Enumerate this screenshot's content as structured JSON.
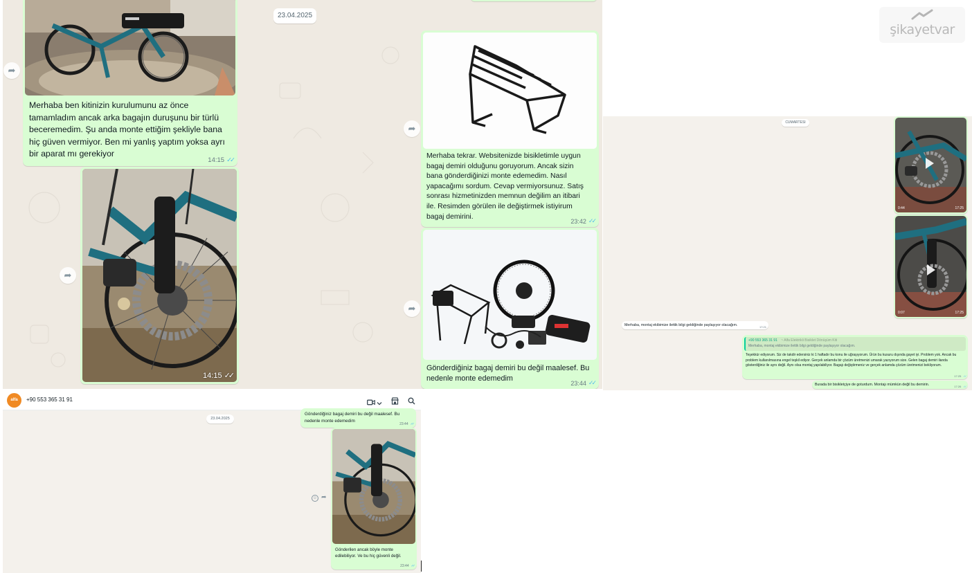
{
  "panel_a": {
    "date_chip": "23.04.2025",
    "msg1_text": "Merhaba ben kitinizin kurulumunu az önce\ntamamladım ancak arka bagajın duruşunu bir türlü\nbeceremedim. Şu anda monte ettiğim şekliyle bana\nhiç güven vermiyor. Ben mi yanlış yaptım yoksa ayrı\nbir aparat mı gerekiyor",
    "msg1_time": "14:15",
    "photo2_time": "14:15",
    "msg2_text": "Merhaba tekrar. Websitenizde bisikletimle uygun\nbagaj demiri olduğunu goruyorum. Ancak sizin\nbana gönderdiğinizi monte edemedim. Nasıl\nyapacağımı sordum. Cevap vermiyorsunuz. Satış\nsonrası hizmetinizden memnun değilim an itibari\nile. Resimden görülen ile değiştirmek istiyirum\nbagaj demirini.",
    "msg2_time": "23:42",
    "msg3_text": "Gönderdiğiniz bagaj demiri bu değil maalesef. Bu\nnedenle monte edemedim",
    "msg3_time": "23:44"
  },
  "panel_b": {
    "date_chip": "CUMARTESI",
    "video1_left": "0:44",
    "video1_right": "17:25",
    "video2_left": "0:07",
    "video2_right": "17:25",
    "incoming_text": "Merhaba, montaj ekibimize ilettik bilgi geldiğinde paylaşıyor olacağım.",
    "incoming_time": "17:21",
    "quote_sender": "+90 553 365 31 91",
    "quote_label": "~ Alfa Elektrikli Bisiklet Dönüşüm Kiti",
    "quote_text": "Merhaba, montaj ekibimize ilettik bilgi geldiğinde paylaşıyor olacağım.",
    "reply_text": "Teşekkür ediyorum. Siz de takdir edersiniz ki 1 haftadır bu konu ile uğraşıyorum. Ürün bu kusuru dışında gayet iyi. Problem yok. Ancak bu problem kullanılmasına engel teşkil ediyor. Gerçek anlamda bir çözüm üretmenizi umarak yazıyorum size. Gelen bagaj demiri ilanda gösterdiğiniz ile aynı değil. Aynı olsa montaj yapılabiliyor. Bagajı değiştirmeniz ve gerçek anlamda çözüm üretmenizi bekliyorum.",
    "reply_time": "17:25",
    "last_text": "Burada bir bisikletçiye de goturdum. Montajı mümkün değil bu demirin.",
    "last_time": "17:26"
  },
  "panel_c": {
    "avatar_text": "alfa",
    "contact_number": "+90 553 365 31 91",
    "date_chip": "23.04.2025",
    "msg1_text": "Gönderdiğiniz bagaj demiri bu değil maalesef. Bu\nnedenle monte edemedim",
    "msg1_time": "23:44",
    "msg2_text": "Gönderilen ancak böyle monte\nedilebiliyor. Ve bu hiç güvenli değil.",
    "msg2_time": "23:44"
  },
  "watermark": {
    "brand": "şikayetvar"
  },
  "colors": {
    "chat_bg": "#efeae2",
    "outgoing_bubble": "#d9fdd3",
    "incoming_bubble": "#ffffff",
    "read_ticks": "#53bdeb",
    "quote_bar": "#06cf9c",
    "avatar": "#f08a24",
    "bike_teal": "#1f6f80"
  },
  "icons": [
    "forward-icon",
    "double-check-icon",
    "video-call-icon",
    "chevron-down-icon",
    "shop-icon",
    "search-icon",
    "emoji-icon",
    "video-icon",
    "play-icon"
  ]
}
